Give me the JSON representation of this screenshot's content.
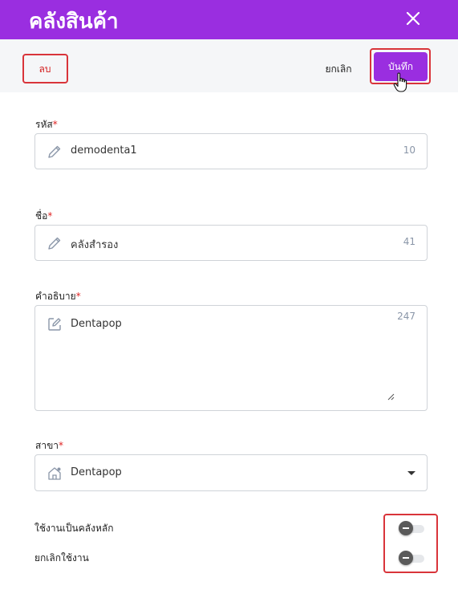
{
  "header": {
    "title": "คลังสินค้า"
  },
  "toolbar": {
    "delete_label": "ลบ",
    "cancel_label": "ยกเลิก",
    "save_label": "บันทึก"
  },
  "form": {
    "code": {
      "label": "รหัส",
      "value": "demodenta1",
      "count": "10"
    },
    "name": {
      "label": "ชื่อ",
      "value": "คลังสำรอง",
      "count": "41"
    },
    "description": {
      "label": "คำอธิบาย",
      "value": "Dentapop",
      "count": "247"
    },
    "branch": {
      "label": "สาขา",
      "value": "Dentapop"
    },
    "required_mark": "*"
  },
  "toggles": {
    "main_warehouse": {
      "label": "ใช้งานเป็นคลังหลัก",
      "on": false
    },
    "disable": {
      "label": "ยกเลิกใช้งาน",
      "on": false
    }
  },
  "colors": {
    "accent": "#9a2ee0",
    "highlight": "#d9343a",
    "danger": "#d31e1e"
  },
  "icons": [
    "close-icon",
    "pencil-icon",
    "edit-square-icon",
    "store-icon",
    "chevron-down-icon",
    "hand-pointer-icon"
  ]
}
